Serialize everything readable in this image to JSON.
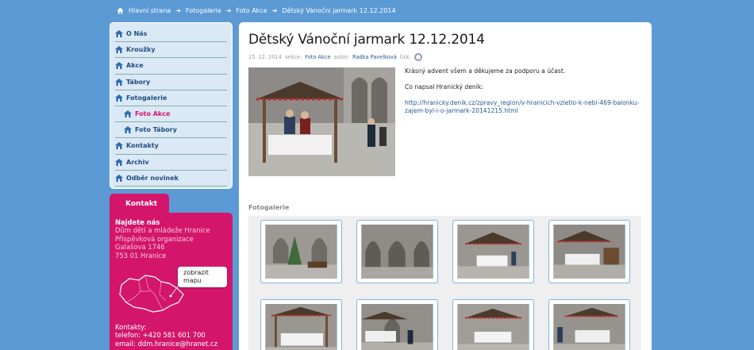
{
  "breadcrumb": {
    "items": [
      "Hlavní strana",
      "Fotogalerie",
      "Foto Akce",
      "Dětský Vánoční jarmark 12.12.2014"
    ],
    "separator": "➔"
  },
  "sidebar": {
    "items": [
      {
        "label": "O Nás",
        "sub": false,
        "active": false
      },
      {
        "label": "Kroužky",
        "sub": false,
        "active": false
      },
      {
        "label": "Akce",
        "sub": false,
        "active": false
      },
      {
        "label": "Tábory",
        "sub": false,
        "active": false
      },
      {
        "label": "Fotogalerie",
        "sub": false,
        "active": false
      },
      {
        "label": "Foto Akce",
        "sub": true,
        "active": true
      },
      {
        "label": "Foto Tábory",
        "sub": true,
        "active": false
      },
      {
        "label": "Kontakty",
        "sub": false,
        "active": false
      },
      {
        "label": "Archiv",
        "sub": false,
        "active": false
      },
      {
        "label": "Odběr novinek",
        "sub": false,
        "active": false
      }
    ]
  },
  "contact": {
    "tab_label": "Kontakt",
    "find_us_label": "Najdete nás",
    "address_lines": [
      "Dům dětí a mládeže Hranice",
      "Příspěvková organizace",
      "Galašova 1746",
      "753 01 Hranice"
    ],
    "map_button": "zobrazit  mapu",
    "contacts_label": "Kontakty:",
    "phone": "telefon: +420 581 601 700",
    "email": "email: ddm.hranice@hranet.cz"
  },
  "article": {
    "title": "Dětský Vánoční jarmark 12.12.2014",
    "date": "15. 12. 2014",
    "section_label": "sekce:",
    "section": "Foto Akce",
    "author_label": "autor:",
    "author": "Radka Pavelková",
    "print_label": "tisk:",
    "paragraph1": "Krásný advent všem a děkujeme za podporu a účast.",
    "paragraph2": "Co napsal Hranický deník:",
    "link": "http://hranicky.denik.cz/zpravy_region/v-hranicich-vzletlo-k-nebi-469-balonku-zajem-byl-i-o-jarmark-20141215.html"
  },
  "gallery": {
    "label": "Fotogalerie",
    "thumb_count": 8
  },
  "colors": {
    "background": "#5c9ad6",
    "accent": "#d3166b",
    "nav_text": "#1f4e80",
    "link": "#1f5a94"
  }
}
